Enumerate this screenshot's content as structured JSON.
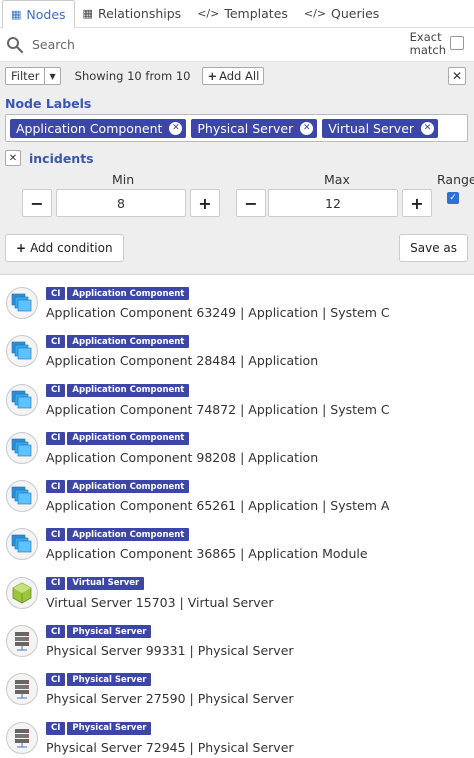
{
  "tabs": [
    {
      "label": "Nodes",
      "icon": "table-icon",
      "active": true
    },
    {
      "label": "Relationships",
      "icon": "table-icon"
    },
    {
      "label": "Templates",
      "icon": "code-icon"
    },
    {
      "label": "Queries",
      "icon": "code-icon"
    }
  ],
  "search": {
    "placeholder": "Search",
    "exact_label_1": "Exact",
    "exact_label_2": "match"
  },
  "filter_bar": {
    "filter_label": "Filter",
    "showing": "Showing 10 from 10",
    "add_all": "Add All"
  },
  "node_labels": {
    "title": "Node Labels",
    "chips": [
      "Application Component",
      "Physical Server",
      "Virtual Server"
    ]
  },
  "condition": {
    "name": "incidents",
    "min_label": "Min",
    "max_label": "Max",
    "min_value": "8",
    "max_value": "12",
    "range_label": "Range",
    "range_checked": true
  },
  "actions": {
    "add_condition": "Add condition",
    "save_as": "Save as"
  },
  "colors": {
    "accent": "#3b46a8",
    "link_blue": "#3b55b3",
    "panel_bg": "#eeeeee"
  },
  "results": [
    {
      "ci": "CI",
      "label": "Application Component",
      "text": "Application Component 63249 | Application | System C",
      "icon": "application-component-icon"
    },
    {
      "ci": "CI",
      "label": "Application Component",
      "text": "Application Component 28484 | Application",
      "icon": "application-component-icon"
    },
    {
      "ci": "CI",
      "label": "Application Component",
      "text": "Application Component 74872 | Application | System C",
      "icon": "application-component-icon"
    },
    {
      "ci": "CI",
      "label": "Application Component",
      "text": "Application Component 98208 | Application",
      "icon": "application-component-icon"
    },
    {
      "ci": "CI",
      "label": "Application Component",
      "text": "Application Component 65261 | Application | System A",
      "icon": "application-component-icon"
    },
    {
      "ci": "CI",
      "label": "Application Component",
      "text": "Application Component 36865 | Application Module",
      "icon": "application-component-icon"
    },
    {
      "ci": "CI",
      "label": "Virtual Server",
      "text": "Virtual Server 15703 | Virtual Server",
      "icon": "virtual-server-icon"
    },
    {
      "ci": "CI",
      "label": "Physical Server",
      "text": "Physical Server 99331 | Physical Server",
      "icon": "physical-server-icon"
    },
    {
      "ci": "CI",
      "label": "Physical Server",
      "text": "Physical Server 27590 | Physical Server",
      "icon": "physical-server-icon"
    },
    {
      "ci": "CI",
      "label": "Physical Server",
      "text": "Physical Server 72945 | Physical Server",
      "icon": "physical-server-icon"
    }
  ]
}
